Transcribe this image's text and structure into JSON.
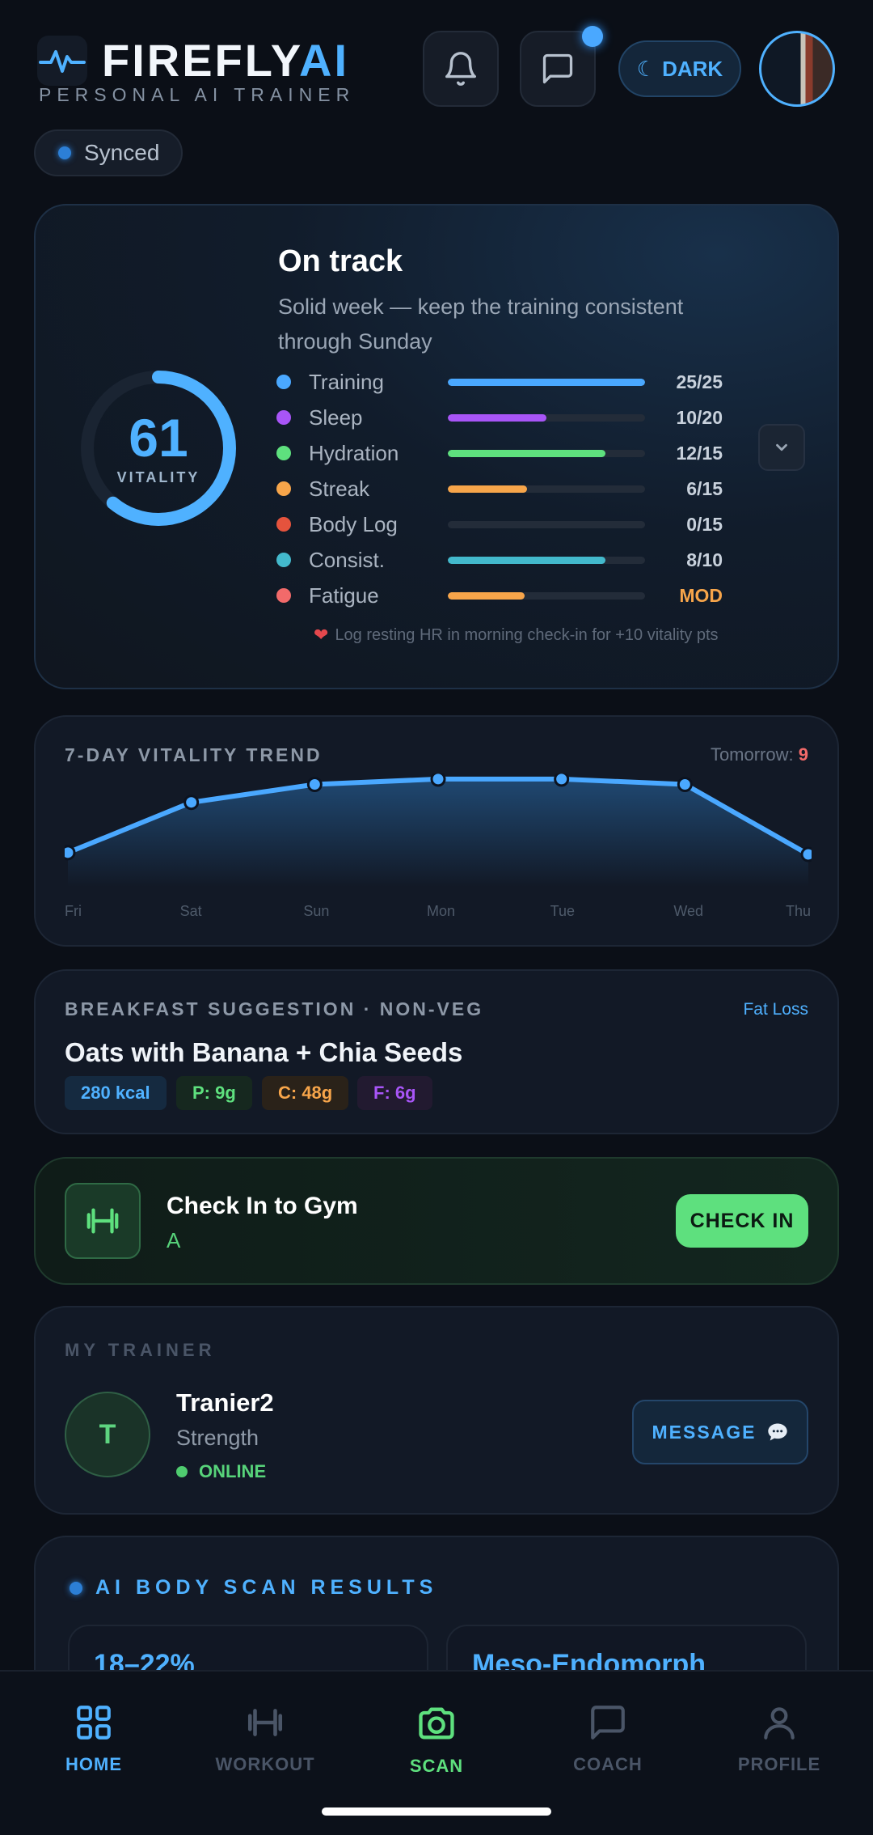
{
  "header": {
    "brand_main": "FIREFLY",
    "brand_accent": "AI",
    "tagline": "PERSONAL AI TRAINER",
    "dark_toggle_label": "DARK",
    "sync_status": "Synced"
  },
  "vitality": {
    "score": "61",
    "score_label": "VITALITY",
    "score_fraction": 0.61,
    "status_title": "On track",
    "status_message": "Solid week — keep the training consistent through Sunday",
    "metrics": [
      {
        "name": "Training",
        "value": "25/25",
        "fraction": 1.0,
        "color": "#4aa8ff"
      },
      {
        "name": "Sleep",
        "value": "10/20",
        "fraction": 0.5,
        "color": "#a855f7"
      },
      {
        "name": "Hydration",
        "value": "12/15",
        "fraction": 0.8,
        "color": "#5ee07e"
      },
      {
        "name": "Streak",
        "value": "6/15",
        "fraction": 0.4,
        "color": "#f7a54a"
      },
      {
        "name": "Body Log",
        "value": "0/15",
        "fraction": 0.0,
        "color": "#e5533d"
      },
      {
        "name": "Consist.",
        "value": "8/10",
        "fraction": 0.8,
        "color": "#43b9cc"
      },
      {
        "name": "Fatigue",
        "value": "MOD",
        "fraction": 0.39,
        "color": "#f7a54a",
        "dot_color": "#f26a6a"
      }
    ],
    "hint": "Log resting HR in morning check-in for +10 vitality pts"
  },
  "trend": {
    "title": "7-DAY VITALITY TREND",
    "tomorrow_label": "Tomorrow:",
    "tomorrow_value": "9",
    "days": [
      "Fri",
      "Sat",
      "Sun",
      "Mon",
      "Tue",
      "Wed",
      "Thu"
    ],
    "values": [
      10,
      38,
      48,
      51,
      51,
      48,
      9
    ]
  },
  "food": {
    "title": "BREAKFAST SUGGESTION · NON-VEG",
    "goal": "Fat Loss",
    "name": "Oats with Banana + Chia Seeds",
    "kcal": "280 kcal",
    "protein": "P: 9g",
    "carbs": "C: 48g",
    "fat": "F: 6g"
  },
  "gym": {
    "title": "Check In to Gym",
    "subtitle": "A",
    "button": "CHECK IN"
  },
  "trainer": {
    "section_title": "MY TRAINER",
    "initial": "T",
    "name": "Tranier2",
    "specialty": "Strength",
    "status": "ONLINE",
    "message_button": "MESSAGE"
  },
  "scan": {
    "title": "AI BODY SCAN RESULTS",
    "tile1": "18–22%",
    "tile2": "Meso-Endomorph"
  },
  "nav": [
    {
      "label": "HOME",
      "icon": "grid-icon",
      "color": "#4fb1ff"
    },
    {
      "label": "WORKOUT",
      "icon": "dumbbell-icon",
      "color": "#4a5567"
    },
    {
      "label": "SCAN",
      "icon": "camera-icon",
      "color": "#5ee07e"
    },
    {
      "label": "COACH",
      "icon": "chat-icon",
      "color": "#4a5567"
    },
    {
      "label": "PROFILE",
      "icon": "person-icon",
      "color": "#4a5567"
    }
  ]
}
